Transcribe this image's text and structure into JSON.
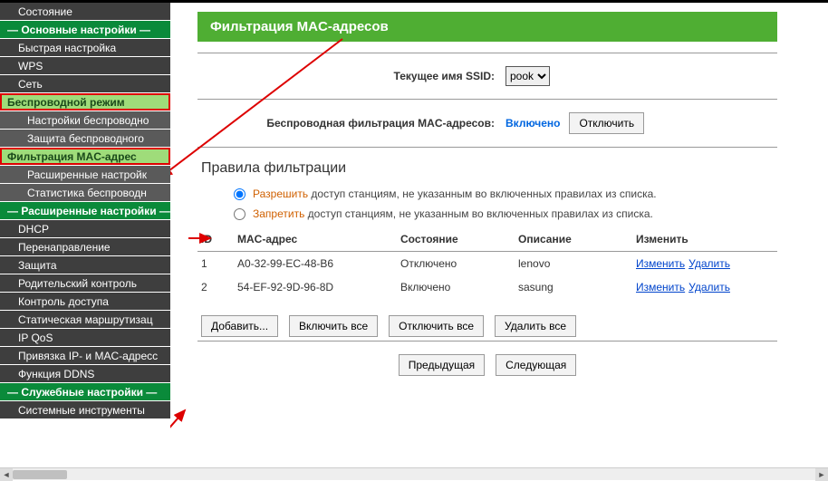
{
  "sidebar": {
    "items": [
      {
        "label": "Состояние",
        "kind": "lvl1"
      },
      {
        "label": "Основные настройки",
        "kind": "section"
      },
      {
        "label": "Быстрая настройка",
        "kind": "lvl1"
      },
      {
        "label": "WPS",
        "kind": "lvl1"
      },
      {
        "label": "Сеть",
        "kind": "lvl1"
      },
      {
        "label": "Беспроводной режим",
        "kind": "open",
        "redbox": true
      },
      {
        "label": "Настройки беспроводно",
        "kind": "lvl2"
      },
      {
        "label": "Защита беспроводного",
        "kind": "lvl2"
      },
      {
        "label": "Фильтрация MAC-адрес",
        "kind": "active",
        "redbox": true
      },
      {
        "label": "Расширенные настройк",
        "kind": "lvl2"
      },
      {
        "label": "Статистика беспроводн",
        "kind": "lvl2"
      },
      {
        "label": "Расширенные настройки",
        "kind": "section"
      },
      {
        "label": "DHCP",
        "kind": "lvl1"
      },
      {
        "label": "Перенаправление",
        "kind": "lvl1"
      },
      {
        "label": "Защита",
        "kind": "lvl1"
      },
      {
        "label": "Родительский контроль",
        "kind": "lvl1"
      },
      {
        "label": "Контроль доступа",
        "kind": "lvl1"
      },
      {
        "label": "Статическая маршрутизац",
        "kind": "lvl1"
      },
      {
        "label": "IP QoS",
        "kind": "lvl1"
      },
      {
        "label": "Привязка IP- и MAC-адресс",
        "kind": "lvl1"
      },
      {
        "label": "Функция DDNS",
        "kind": "lvl1"
      },
      {
        "label": "Служебные настройки",
        "kind": "section"
      },
      {
        "label": "Системные инструменты",
        "kind": "lvl1"
      }
    ]
  },
  "page": {
    "title": "Фильтрация MAC-адресов",
    "ssid_label": "Текущее имя SSID:",
    "ssid_value": "pook",
    "filter_label": "Беспроводная фильтрация MAC-адресов:",
    "filter_state": "Включено",
    "filter_button": "Отключить",
    "rules_heading": "Правила фильтрации",
    "rule_allow_kw": "Разрешить",
    "rule_allow_txt": " доступ станциям, не указанным во включенных правилах из списка.",
    "rule_deny_kw": "Запретить",
    "rule_deny_txt": " доступ станциям, не указанным во включенных правилах из списка.",
    "rule_selected": "allow",
    "columns": {
      "id": "ID",
      "mac": "MAC-адрес",
      "state": "Состояние",
      "desc": "Описание",
      "modify": "Изменить"
    },
    "link_edit": "Изменить",
    "link_delete": "Удалить",
    "rows": [
      {
        "id": "1",
        "mac": "A0-32-99-EC-48-B6",
        "state": "Отключено",
        "desc": "lenovo"
      },
      {
        "id": "2",
        "mac": "54-EF-92-9D-96-8D",
        "state": "Включено",
        "desc": "sasung"
      }
    ],
    "actions": {
      "add": "Добавить...",
      "enable_all": "Включить все",
      "disable_all": "Отключить все",
      "delete_all": "Удалить все"
    },
    "paging": {
      "prev": "Предыдущая",
      "next": "Следующая"
    }
  }
}
